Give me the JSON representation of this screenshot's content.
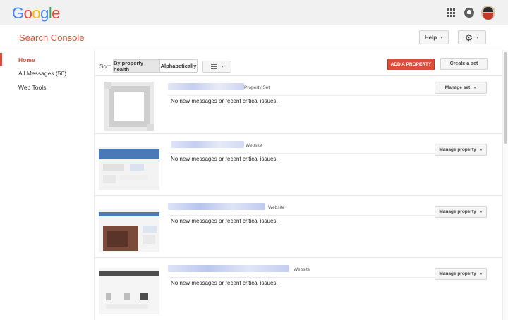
{
  "header": {
    "logo_letters": [
      {
        "char": "G",
        "color": "#4285F4"
      },
      {
        "char": "o",
        "color": "#EA4335"
      },
      {
        "char": "o",
        "color": "#FBBC05"
      },
      {
        "char": "g",
        "color": "#4285F4"
      },
      {
        "char": "l",
        "color": "#34A853"
      },
      {
        "char": "e",
        "color": "#EA4335"
      }
    ],
    "icons": [
      "apps-grid-icon",
      "notifications-icon",
      "account-avatar"
    ]
  },
  "product": {
    "title": "Search Console",
    "help_label": "Help",
    "settings_icon": "gear-icon",
    "accent_color": "#dd4b39"
  },
  "sidebar": {
    "items": [
      {
        "label": "Home",
        "active": true
      },
      {
        "label": "All Messages (50)",
        "active": false
      },
      {
        "label": "Web Tools",
        "active": false
      }
    ]
  },
  "toolbar": {
    "sort_label": "Sort:",
    "sort_options": [
      {
        "label": "By property health",
        "selected": true
      },
      {
        "label": "Alphabetically",
        "selected": false
      }
    ],
    "view_icon": "list-view-icon",
    "add_property_label": "ADD A PROPERTY",
    "create_set_label": "Create a set"
  },
  "properties": [
    {
      "type": "Property Set",
      "status": "No new messages or recent critical issues.",
      "action": "Manage set"
    },
    {
      "type": "Website",
      "status": "No new messages or recent critical issues.",
      "action": "Manage property"
    },
    {
      "type": "Website",
      "status": "No new messages or recent critical issues.",
      "action": "Manage property"
    },
    {
      "type": "Website",
      "status": "No new messages or recent critical issues.",
      "action": "Manage property"
    }
  ]
}
